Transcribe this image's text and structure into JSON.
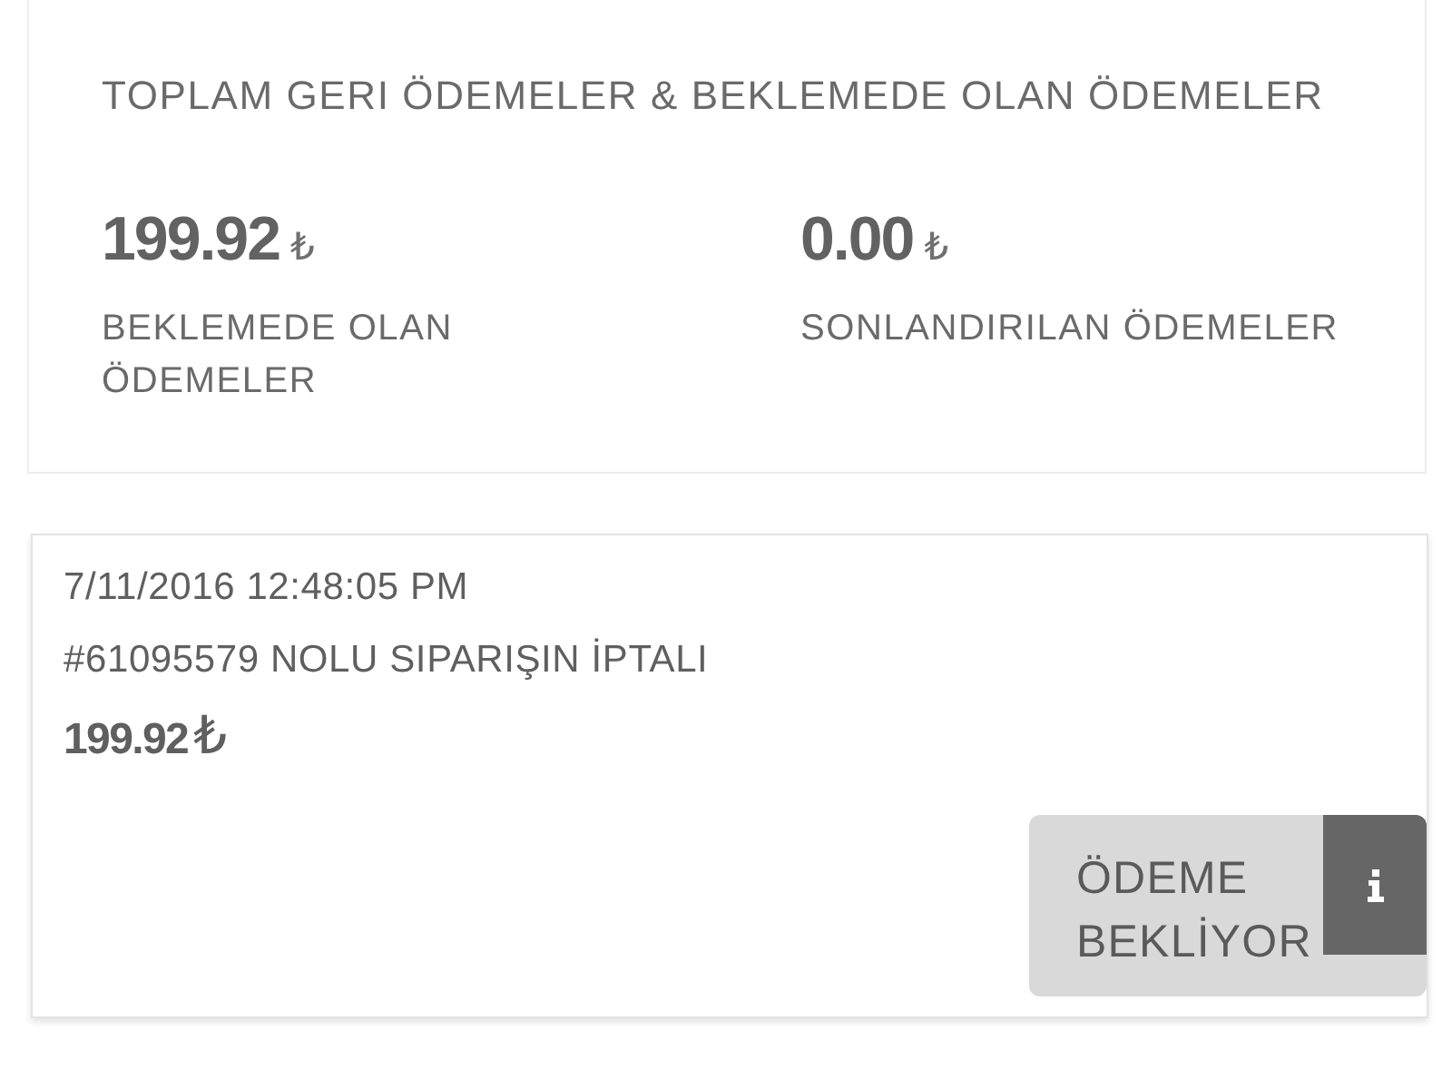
{
  "summary": {
    "title": "TOPLAM GERI ÖDEMELER & BEKLEMEDE OLAN ÖDEMELER",
    "stats": [
      {
        "amount": "199.92",
        "currency": "₺",
        "label": "BEKLEMEDE OLAN ÖDEMELER"
      },
      {
        "amount": "0.00",
        "currency": "₺",
        "label": "SONLANDIRILAN ÖDEMELER"
      }
    ]
  },
  "transactions": [
    {
      "date": "7/11/2016 12:48:05 PM",
      "description": "#61095579 NOLU SIPARIŞIN İPTALI",
      "amount": "199.92",
      "currency": "₺",
      "status": "ÖDEME BEKLİYOR"
    }
  ]
}
